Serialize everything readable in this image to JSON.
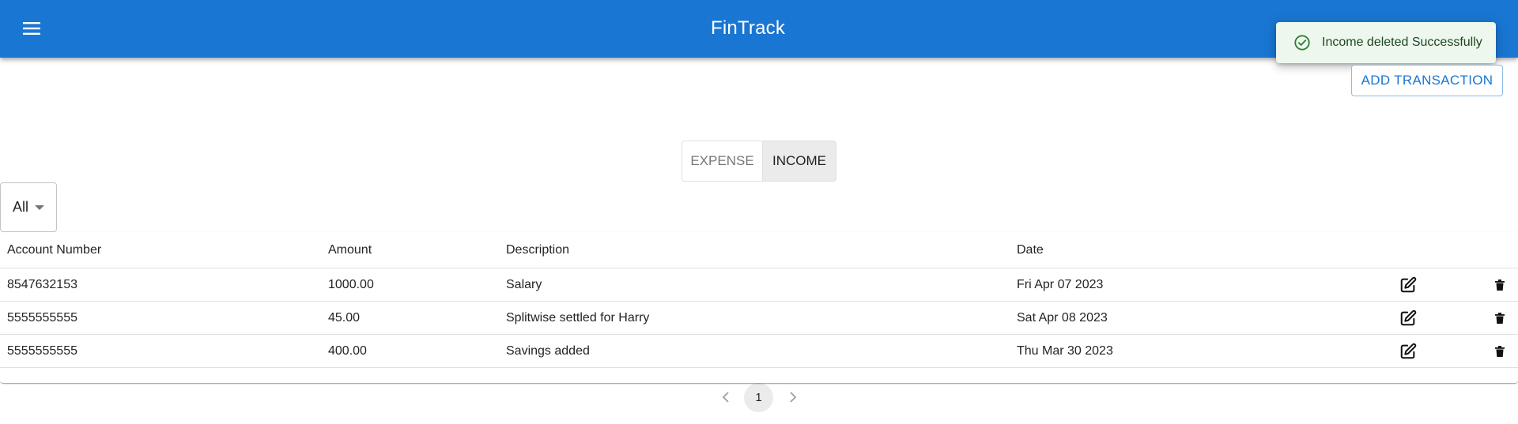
{
  "app": {
    "title": "FinTrack"
  },
  "toast": {
    "message": "Income deleted Successfully"
  },
  "actions": {
    "add_transaction": "ADD TRANSACTION"
  },
  "toggle": {
    "expense": "EXPENSE",
    "income": "INCOME",
    "selected": "INCOME"
  },
  "filter": {
    "value": "All"
  },
  "table": {
    "headers": [
      "Account Number",
      "Amount",
      "Description",
      "Date"
    ],
    "rows": [
      [
        "8547632153",
        "1000.00",
        "Salary",
        "Fri Apr 07 2023"
      ],
      [
        "5555555555",
        "45.00",
        "Splitwise settled for Harry",
        "Sat Apr 08 2023"
      ],
      [
        "5555555555",
        "400.00",
        "Savings added",
        "Thu Mar 30 2023"
      ]
    ]
  },
  "pagination": {
    "current_page": "1"
  },
  "colors": {
    "primary": "#1976d2",
    "success_bg": "#edf7ed",
    "success_icon": "#2e7d32"
  },
  "icons": {
    "menu": "menu-icon",
    "success": "check-circle-outline-icon",
    "edit": "edit-square-icon",
    "delete": "trash-icon",
    "prev": "chevron-left-icon",
    "next": "chevron-right-icon"
  }
}
